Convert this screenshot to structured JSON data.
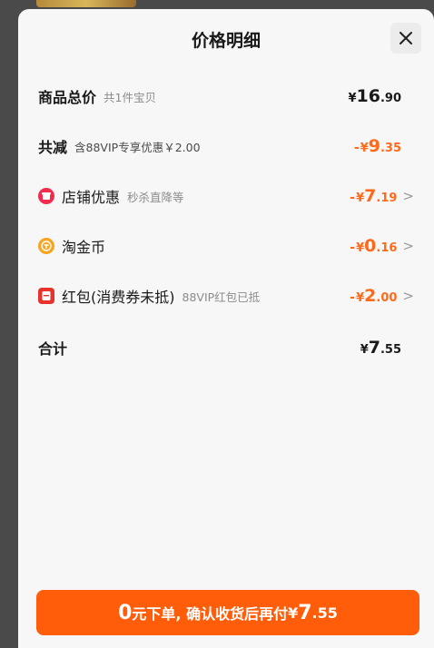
{
  "header": {
    "title": "价格明细",
    "close_icon": "close-icon"
  },
  "rows": {
    "subtotal": {
      "label": "商品总价",
      "sub": "共1件宝贝",
      "currency": "¥",
      "int": "16",
      "dec": ".90"
    },
    "reduction": {
      "label": "共减",
      "sub": "含88VIP专享优惠￥2.00",
      "minus": "-",
      "currency": "¥",
      "int": "9",
      "dec": ".35"
    },
    "store_discount": {
      "icon": "store-icon",
      "label": "店铺优惠",
      "sub": "秒杀直降等",
      "minus": "-",
      "currency": "¥",
      "int": "7",
      "dec": ".19",
      "chevron": ">"
    },
    "taojinbi": {
      "icon": "coin-icon",
      "label": "淘金币",
      "minus": "-",
      "currency": "¥",
      "int": "0",
      "dec": ".16",
      "chevron": ">"
    },
    "red_packet": {
      "icon": "red-packet-icon",
      "label": "红包(消费券未抵)",
      "sub": "88VIP红包已抵",
      "minus": "-",
      "currency": "¥",
      "int": "2",
      "dec": ".00",
      "chevron": ">"
    },
    "total": {
      "label": "合计",
      "currency": "¥",
      "int": "7",
      "dec": ".55"
    }
  },
  "footer": {
    "zero": "0",
    "text": "元下单, 确认收货后再付",
    "currency": "¥",
    "int": "7",
    "dec": ".55"
  },
  "colors": {
    "accent": "#ff6a1a",
    "button": "#ff5d0a",
    "store_icon": "#f02d4f",
    "coin_icon": "#f6a623",
    "red_packet_icon": "#e8332c"
  }
}
